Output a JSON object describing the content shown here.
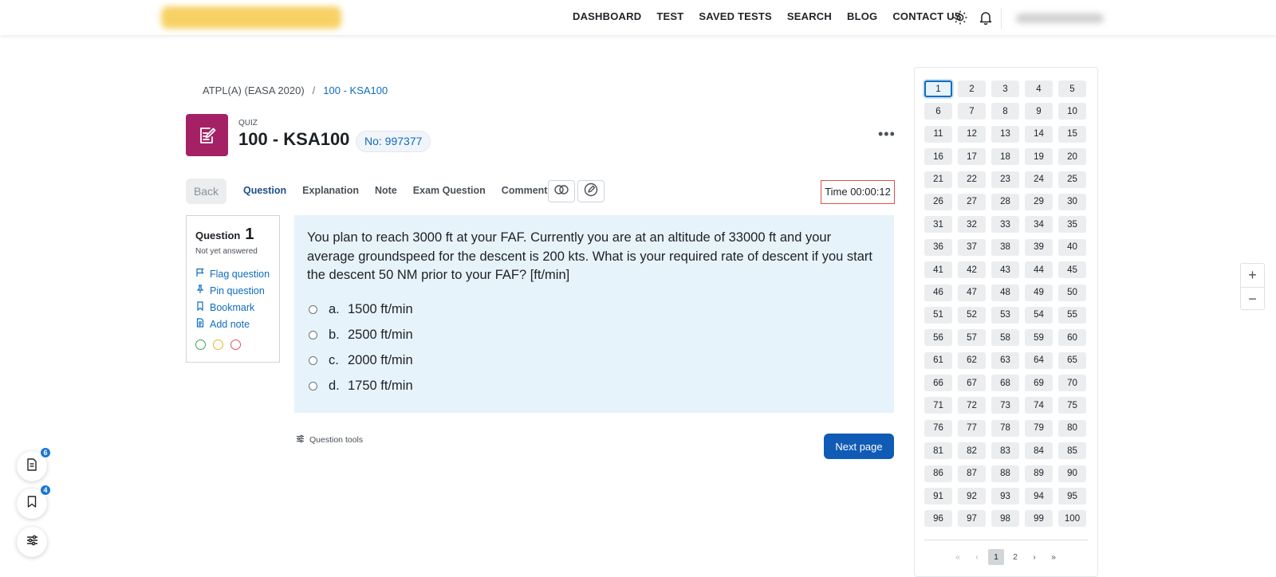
{
  "navbar": {
    "links": [
      "DASHBOARD",
      "TEST",
      "SAVED TESTS",
      "SEARCH",
      "BLOG",
      "CONTACT US"
    ]
  },
  "breadcrumb": {
    "course": "ATPL(A) (EASA 2020)",
    "separator": "/",
    "current": "100 - KSA100"
  },
  "header": {
    "label": "QUIZ",
    "title": "100 - KSA100",
    "number": "No: 997377"
  },
  "toolbar": {
    "back_label": "Back",
    "tabs": [
      "Question",
      "Explanation",
      "Note",
      "Exam Question",
      "Comments"
    ],
    "timer": "Time 00:00:12"
  },
  "question_info": {
    "label": "Question",
    "number": "1",
    "status": "Not yet answered",
    "actions": {
      "flag": "Flag question",
      "pin": "Pin question",
      "bookmark": "Bookmark",
      "note": "Add note"
    },
    "status_colors": [
      "#3aa757",
      "#e0b82e",
      "#e05656"
    ]
  },
  "question": {
    "text": "You plan to reach 3000 ft at your FAF. Currently you are at an altitude of 33000 ft and your average groundspeed for the descent is 200 kts. What is your required rate of descent if you start the descent 50 NM prior to your FAF? [ft/min]",
    "answers": [
      {
        "letter": "a.",
        "text": "1500 ft/min"
      },
      {
        "letter": "b.",
        "text": "2500 ft/min"
      },
      {
        "letter": "c.",
        "text": "2000 ft/min"
      },
      {
        "letter": "d.",
        "text": "1750 ft/min"
      }
    ]
  },
  "footer": {
    "tools_label": "Question tools",
    "next_label": "Next page"
  },
  "navigation": {
    "current": 1,
    "pager": [
      "«",
      "‹",
      "1",
      "2",
      "›",
      "»"
    ]
  },
  "zoom": {
    "plus": "+",
    "minus": "−"
  },
  "fabs": {
    "notes_badge": "6",
    "bookmarks_badge": "4"
  },
  "colors": {
    "accent": "#0f6cbf",
    "quiz_icon_bg": "#a52166",
    "next_button": "#0f5bb6"
  }
}
